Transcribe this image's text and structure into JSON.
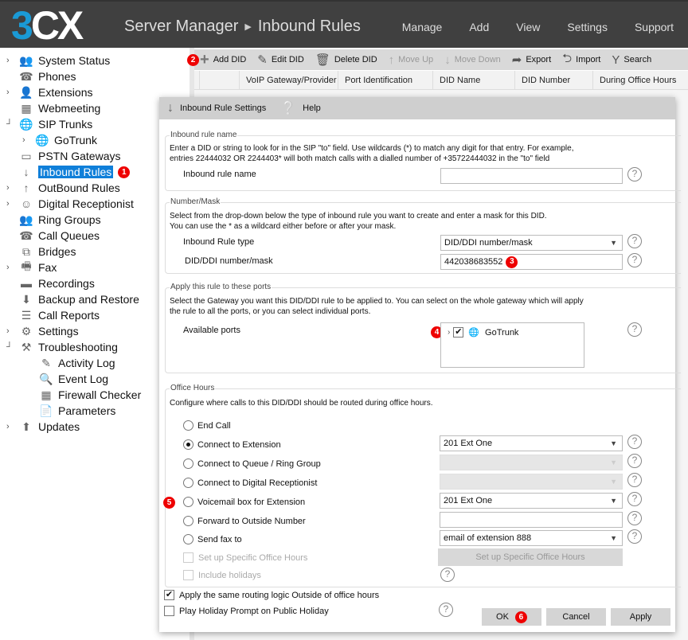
{
  "header": {
    "logo_three": "3",
    "logo_cx": "CX",
    "app_title": "Server Manager",
    "separator": "▶",
    "page_title": "Inbound Rules",
    "menu": [
      "Manage",
      "Add",
      "View",
      "Settings",
      "Support"
    ]
  },
  "sidebar": {
    "items": [
      {
        "label": "System Status",
        "icon": "system-status-icon",
        "expandable": true
      },
      {
        "label": "Phones",
        "icon": "phone-icon",
        "expandable": false
      },
      {
        "label": "Extensions",
        "icon": "user-icon",
        "expandable": true
      },
      {
        "label": "Webmeeting",
        "icon": "webmeeting-icon",
        "expandable": false
      },
      {
        "label": "SIP Trunks",
        "icon": "globe-icon",
        "expandable": true,
        "expanded": true
      },
      {
        "label": "GoTrunk",
        "icon": "globe-icon",
        "expandable": true,
        "child": true
      },
      {
        "label": "PSTN Gateways",
        "icon": "gateway-icon",
        "expandable": false
      },
      {
        "label": "Inbound Rules",
        "icon": "arrow-down-icon",
        "expandable": false,
        "selected": true,
        "badge": "1"
      },
      {
        "label": "OutBound Rules",
        "icon": "arrow-up-icon",
        "expandable": true
      },
      {
        "label": "Digital Receptionist",
        "icon": "receptionist-icon",
        "expandable": true
      },
      {
        "label": "Ring Groups",
        "icon": "group-icon",
        "expandable": false
      },
      {
        "label": "Call Queues",
        "icon": "queue-icon",
        "expandable": false
      },
      {
        "label": "Bridges",
        "icon": "bridge-icon",
        "expandable": false
      },
      {
        "label": "Fax",
        "icon": "fax-icon",
        "expandable": true
      },
      {
        "label": "Recordings",
        "icon": "folder-icon",
        "expandable": false
      },
      {
        "label": "Backup and Restore",
        "icon": "backup-icon",
        "expandable": false
      },
      {
        "label": "Call Reports",
        "icon": "report-icon",
        "expandable": false
      },
      {
        "label": "Settings",
        "icon": "gear-icon",
        "expandable": true
      },
      {
        "label": "Troubleshooting",
        "icon": "troubleshooting-icon",
        "expandable": true,
        "expanded": true
      },
      {
        "label": "Activity Log",
        "icon": "activity-log-icon",
        "child": true
      },
      {
        "label": "Event Log",
        "icon": "event-log-icon",
        "child": true
      },
      {
        "label": "Firewall Checker",
        "icon": "firewall-icon",
        "child": true
      },
      {
        "label": "Parameters",
        "icon": "parameters-icon",
        "child": true
      },
      {
        "label": "Updates",
        "icon": "upload-icon",
        "expandable": true
      }
    ]
  },
  "toolbar": {
    "badge": "2",
    "buttons": [
      {
        "label": "Add DID",
        "icon": "plus-icon",
        "disabled": false
      },
      {
        "label": "Edit DID",
        "icon": "pencil-icon",
        "disabled": false
      },
      {
        "label": "Delete DID",
        "icon": "trash-icon",
        "disabled": false
      },
      {
        "label": "Move Up",
        "icon": "arrow-up-icon",
        "disabled": true
      },
      {
        "label": "Move Down",
        "icon": "arrow-down-icon",
        "disabled": true
      },
      {
        "label": "Export",
        "icon": "export-icon",
        "disabled": false
      },
      {
        "label": "Import",
        "icon": "import-icon",
        "disabled": false
      },
      {
        "label": "Search",
        "icon": "filter-icon",
        "disabled": false
      }
    ]
  },
  "grid": {
    "columns": [
      "VoIP Gateway/Provider",
      "Port Identification",
      "DID Name",
      "DID Number",
      "During Office Hours"
    ]
  },
  "dialog": {
    "tabs": {
      "settings": "Inbound Rule Settings",
      "help": "Help"
    },
    "rule_name": {
      "legend": "Inbound rule name",
      "desc1": "Enter a DID or string to look for in the SIP \"to\" field. Use wildcards (*) to match any digit for that entry. For example,",
      "desc2": "entries 22444032 OR 2244403* will both match calls with a dialled number of +35722444032 in the \"to\" field",
      "label": "Inbound rule name",
      "value": ""
    },
    "number_mask": {
      "legend": "Number/Mask",
      "desc1": "Select from the drop-down below the type of inbound rule you want to create and enter a mask for this DID.",
      "desc2": "You can use the * as a wildcard either before or after your mask.",
      "type_label": "Inbound Rule type",
      "type_value": "DID/DDI number/mask",
      "mask_label": "DID/DDI number/mask",
      "mask_value": "442038683552",
      "badge": "3"
    },
    "ports": {
      "legend": "Apply this rule to these ports",
      "desc1": "Select the Gateway you want this DID/DDI rule to be applied to. You can select on the whole gateway which will apply",
      "desc2": "the rule to all the ports, or you can select individual ports.",
      "label": "Available ports",
      "badge": "4",
      "items": [
        {
          "label": "GoTrunk",
          "checked": true
        }
      ]
    },
    "office_hours": {
      "legend": "Office Hours",
      "desc": "Configure where calls to this DID/DDI should be routed during office hours.",
      "badge": "5",
      "options": [
        {
          "label": "End Call",
          "selected": false
        },
        {
          "label": "Connect to Extension",
          "selected": true,
          "value": "201 Ext One"
        },
        {
          "label": "Connect to Queue / Ring Group",
          "selected": false,
          "value": ""
        },
        {
          "label": "Connect to Digital Receptionist",
          "selected": false,
          "value": ""
        },
        {
          "label": "Voicemail box for Extension",
          "selected": false,
          "value": "201 Ext One"
        },
        {
          "label": "Forward to Outside Number",
          "selected": false,
          "value": ""
        },
        {
          "label": "Send fax to",
          "selected": false,
          "value": "email of extension 888"
        }
      ],
      "specific_hours_label": "Set up Specific Office Hours",
      "specific_hours_button": "Set up Specific Office Hours",
      "include_holidays_label": "Include holidays"
    },
    "apply_same_logic": {
      "label": "Apply the same routing logic Outside of office hours",
      "checked": true
    },
    "holiday_prompt": {
      "label": "Play Holiday Prompt on Public Holiday",
      "checked": false
    },
    "buttons": {
      "ok": "OK",
      "cancel": "Cancel",
      "apply": "Apply",
      "ok_badge": "6"
    },
    "help_glyph": "?",
    "check_glyph": "✔"
  }
}
